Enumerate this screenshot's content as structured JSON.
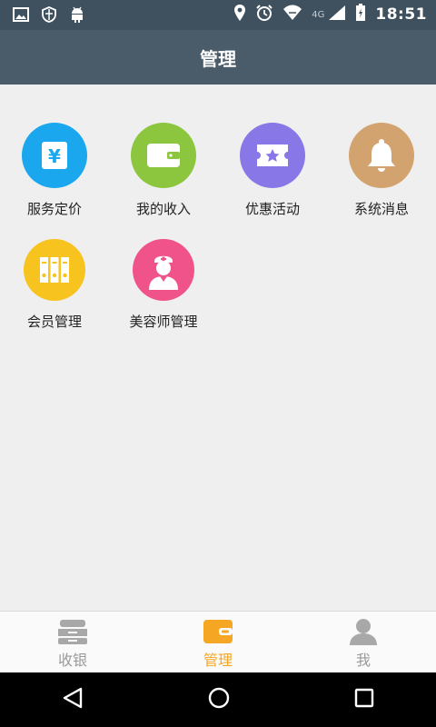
{
  "status_bar": {
    "time": "18:51",
    "network": "4G"
  },
  "header": {
    "title": "管理"
  },
  "grid_items": [
    {
      "label": "服务定价",
      "icon": "yuan-icon",
      "color": "#1aa7ee"
    },
    {
      "label": "我的收入",
      "icon": "wallet-icon",
      "color": "#8cc63f"
    },
    {
      "label": "优惠活动",
      "icon": "ticket-star-icon",
      "color": "#8877e6"
    },
    {
      "label": "系统消息",
      "icon": "bell-icon",
      "color": "#d3a36f"
    },
    {
      "label": "会员管理",
      "icon": "binders-icon",
      "color": "#f7c31e"
    },
    {
      "label": "美容师管理",
      "icon": "nurse-icon",
      "color": "#f0538a"
    }
  ],
  "tabs": [
    {
      "label": "收银",
      "icon": "cash-register-icon",
      "active": false
    },
    {
      "label": "管理",
      "icon": "wallet-icon",
      "active": true
    },
    {
      "label": "我",
      "icon": "person-icon",
      "active": false
    }
  ],
  "colors": {
    "status_bar": "#3f505e",
    "title_bar": "#4a5b69",
    "background": "#efefef",
    "accent": "#f5a623",
    "tab_inactive": "#9a9a9a"
  }
}
